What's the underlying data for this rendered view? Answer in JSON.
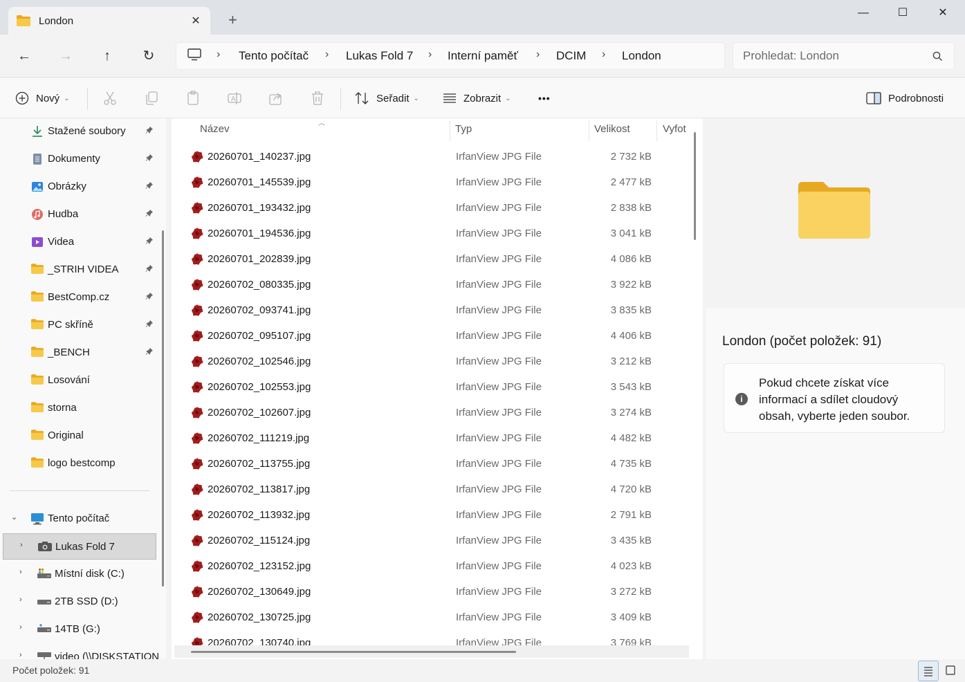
{
  "window": {
    "tab_title": "London",
    "tab_close": "✕",
    "new_tab": "+",
    "minimize": "—",
    "maximize": "☐",
    "close": "✕"
  },
  "nav": {
    "back": "←",
    "forward": "→",
    "up": "↑",
    "refresh": "↻"
  },
  "breadcrumb": [
    "Tento počítač",
    "Lukas Fold 7",
    "Interní paměť",
    "DCIM",
    "London"
  ],
  "search": {
    "placeholder": "Prohledat: London"
  },
  "toolbar": {
    "new_label": "Nový",
    "sort_label": "Seřadit",
    "view_label": "Zobrazit",
    "more_label": "•••",
    "details_label": "Podrobnosti"
  },
  "sidebar": {
    "quick_access": [
      {
        "label": "Stažené soubory",
        "icon": "download-icon",
        "pinned": true
      },
      {
        "label": "Dokumenty",
        "icon": "documents-icon",
        "pinned": true
      },
      {
        "label": "Obrázky",
        "icon": "pictures-icon",
        "pinned": true
      },
      {
        "label": "Hudba",
        "icon": "music-icon",
        "pinned": true
      },
      {
        "label": "Videa",
        "icon": "videos-icon",
        "pinned": true
      },
      {
        "label": "_STRIH VIDEA",
        "icon": "folder-icon",
        "pinned": true
      },
      {
        "label": "BestComp.cz",
        "icon": "folder-icon",
        "pinned": true
      },
      {
        "label": "PC skříně",
        "icon": "folder-icon",
        "pinned": true
      },
      {
        "label": "_BENCH",
        "icon": "folder-icon",
        "pinned": true
      },
      {
        "label": "Losování",
        "icon": "folder-icon",
        "pinned": false
      },
      {
        "label": "storna",
        "icon": "folder-icon",
        "pinned": false
      },
      {
        "label": "Original",
        "icon": "folder-icon",
        "pinned": false
      },
      {
        "label": "logo bestcomp",
        "icon": "folder-icon",
        "pinned": false
      }
    ],
    "this_pc": "Tento počítač",
    "drives": [
      {
        "label": "Lukas Fold 7",
        "icon": "camera-icon",
        "selected": true
      },
      {
        "label": "Místní disk (C:)",
        "icon": "system-drive-icon",
        "selected": false
      },
      {
        "label": "2TB SSD (D:)",
        "icon": "drive-icon",
        "selected": false
      },
      {
        "label": "14TB (G:)",
        "icon": "usb-drive-icon",
        "selected": false
      },
      {
        "label": "video (\\\\DISKSTATION",
        "icon": "network-drive-icon",
        "selected": false
      }
    ],
    "pin_glyph": "📌"
  },
  "columns": {
    "name": "Název",
    "type": "Typ",
    "size": "Velikost",
    "taken": "Vyfot"
  },
  "files": [
    {
      "name": "20260701_140237.jpg",
      "type": "IrfanView JPG File",
      "size": "2 732 kB"
    },
    {
      "name": "20260701_145539.jpg",
      "type": "IrfanView JPG File",
      "size": "2 477 kB"
    },
    {
      "name": "20260701_193432.jpg",
      "type": "IrfanView JPG File",
      "size": "2 838 kB"
    },
    {
      "name": "20260701_194536.jpg",
      "type": "IrfanView JPG File",
      "size": "3 041 kB"
    },
    {
      "name": "20260701_202839.jpg",
      "type": "IrfanView JPG File",
      "size": "4 086 kB"
    },
    {
      "name": "20260702_080335.jpg",
      "type": "IrfanView JPG File",
      "size": "3 922 kB"
    },
    {
      "name": "20260702_093741.jpg",
      "type": "IrfanView JPG File",
      "size": "3 835 kB"
    },
    {
      "name": "20260702_095107.jpg",
      "type": "IrfanView JPG File",
      "size": "4 406 kB"
    },
    {
      "name": "20260702_102546.jpg",
      "type": "IrfanView JPG File",
      "size": "3 212 kB"
    },
    {
      "name": "20260702_102553.jpg",
      "type": "IrfanView JPG File",
      "size": "3 543 kB"
    },
    {
      "name": "20260702_102607.jpg",
      "type": "IrfanView JPG File",
      "size": "3 274 kB"
    },
    {
      "name": "20260702_111219.jpg",
      "type": "IrfanView JPG File",
      "size": "4 482 kB"
    },
    {
      "name": "20260702_113755.jpg",
      "type": "IrfanView JPG File",
      "size": "4 735 kB"
    },
    {
      "name": "20260702_113817.jpg",
      "type": "IrfanView JPG File",
      "size": "4 720 kB"
    },
    {
      "name": "20260702_113932.jpg",
      "type": "IrfanView JPG File",
      "size": "2 791 kB"
    },
    {
      "name": "20260702_115124.jpg",
      "type": "IrfanView JPG File",
      "size": "3 435 kB"
    },
    {
      "name": "20260702_123152.jpg",
      "type": "IrfanView JPG File",
      "size": "4 023 kB"
    },
    {
      "name": "20260702_130649.jpg",
      "type": "IrfanView JPG File",
      "size": "3 272 kB"
    },
    {
      "name": "20260702_130725.jpg",
      "type": "IrfanView JPG File",
      "size": "3 409 kB"
    },
    {
      "name": "20260702_130740.jpg",
      "type": "IrfanView JPG File",
      "size": "3 769 kB"
    }
  ],
  "details": {
    "title": "London (počet položek: 91)",
    "info_glyph": "i",
    "info_text": "Pokud chcete získat více informací a sdílet cloudový obsah, vyberte jeden soubor."
  },
  "status": {
    "item_count": "Počet položek: 91"
  },
  "colors": {
    "folder": "#f7c948",
    "folder_dark": "#e8a922",
    "irfanview": "#a21c1c",
    "accent": "#005fb8"
  }
}
